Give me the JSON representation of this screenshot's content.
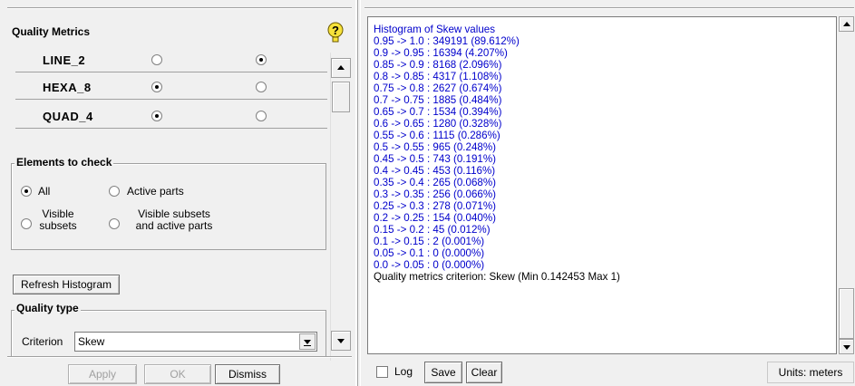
{
  "quality_metrics": {
    "title": "Quality Metrics",
    "help_icon": "help-question-icon",
    "elements": [
      {
        "name": "LINE_2",
        "col1_checked": false,
        "col2_checked": true
      },
      {
        "name": "HEXA_8",
        "col1_checked": true,
        "col2_checked": false
      },
      {
        "name": "QUAD_4",
        "col1_checked": true,
        "col2_checked": false
      }
    ]
  },
  "elements_to_check": {
    "title": "Elements to check",
    "options": [
      {
        "label": "All",
        "checked": true
      },
      {
        "label": "Active parts",
        "checked": false
      },
      {
        "label_line1": "Visible",
        "label_line2": "subsets",
        "checked": false
      },
      {
        "label_line1": "Visible subsets",
        "label_line2": "and active parts",
        "checked": false
      }
    ]
  },
  "refresh_histogram_label": "Refresh Histogram",
  "quality_type": {
    "title": "Quality type",
    "criterion_label": "Criterion",
    "criterion_value": "Skew"
  },
  "dialog_buttons": {
    "apply": "Apply",
    "ok": "OK",
    "dismiss": "Dismiss"
  },
  "histogram": {
    "title": "Histogram of Skew values",
    "lines": [
      "0.95 -> 1.0 : 349191 (89.612%)",
      "0.9 -> 0.95 : 16394 (4.207%)",
      "0.85 -> 0.9 : 8168 (2.096%)",
      "0.8 -> 0.85 : 4317 (1.108%)",
      "0.75 -> 0.8 : 2627 (0.674%)",
      "0.7 -> 0.75 : 1885 (0.484%)",
      "0.65 -> 0.7 : 1534 (0.394%)",
      "0.6 -> 0.65 : 1280 (0.328%)",
      "0.55 -> 0.6 : 1115 (0.286%)",
      "0.5 -> 0.55 : 965 (0.248%)",
      "0.45 -> 0.5 : 743 (0.191%)",
      "0.4 -> 0.45 : 453 (0.116%)",
      "0.35 -> 0.4 : 265 (0.068%)",
      "0.3 -> 0.35 : 256 (0.066%)",
      "0.25 -> 0.3 : 278 (0.071%)",
      "0.2 -> 0.25 : 154 (0.040%)",
      "0.15 -> 0.2 : 45 (0.012%)",
      "0.1 -> 0.15 : 2 (0.001%)",
      "0.05 -> 0.1 : 0 (0.000%)",
      "0.0 -> 0.05 : 0 (0.000%)"
    ],
    "summary": "Quality metrics criterion: Skew (Min 0.142453 Max 1)"
  },
  "bottom_bar": {
    "log_label": "Log",
    "log_checked": false,
    "save_label": "Save",
    "clear_label": "Clear",
    "units_label": "Units: meters"
  },
  "colors": {
    "histogram_text": "#0000cc",
    "panel_bg": "#f0f0f0"
  }
}
